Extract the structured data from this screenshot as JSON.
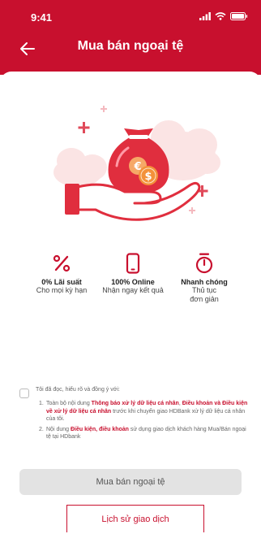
{
  "status": {
    "time": "9:41"
  },
  "header": {
    "title": "Mua bán ngoại tệ"
  },
  "features": [
    {
      "icon": "percent-icon",
      "title": "0% Lãi suất",
      "desc_lines": [
        "Cho mọi kỳ hạn"
      ]
    },
    {
      "icon": "smartphone-icon",
      "title": "100% Online",
      "desc_lines": [
        "Nhận ngay kết quả"
      ]
    },
    {
      "icon": "stopwatch-icon",
      "title": "Nhanh chóng",
      "desc_lines": [
        "Thủ tục",
        "đơn giản"
      ]
    }
  ],
  "terms": {
    "intro": "Tôi đã đọc, hiểu rõ và đồng ý với:",
    "item1": {
      "num": "1.",
      "pre": "Toàn bộ nội dung ",
      "link1": "Thông báo xử lý dữ liệu cá nhân",
      "sep": ", ",
      "link2": "Điều khoản và Điều kiện về xử lý dữ liệu cá nhân",
      "post": " trước khi chuyển giao HDBank xử lý dữ liệu cá nhân của tôi."
    },
    "item2": {
      "num": "2.",
      "pre": "Nội dung ",
      "link": "Điều kiện, điều khoản",
      "post": " sử dụng giao dịch khách hàng Mua/Bán ngoại tệ tại HDbank"
    }
  },
  "buttons": {
    "primary_label": "Mua bán ngoại tệ",
    "history_label": "Lịch sử giao dịch"
  },
  "colors": {
    "brand": "#c8102e",
    "coin": "#f3913a",
    "cloud": "#f7dede"
  }
}
